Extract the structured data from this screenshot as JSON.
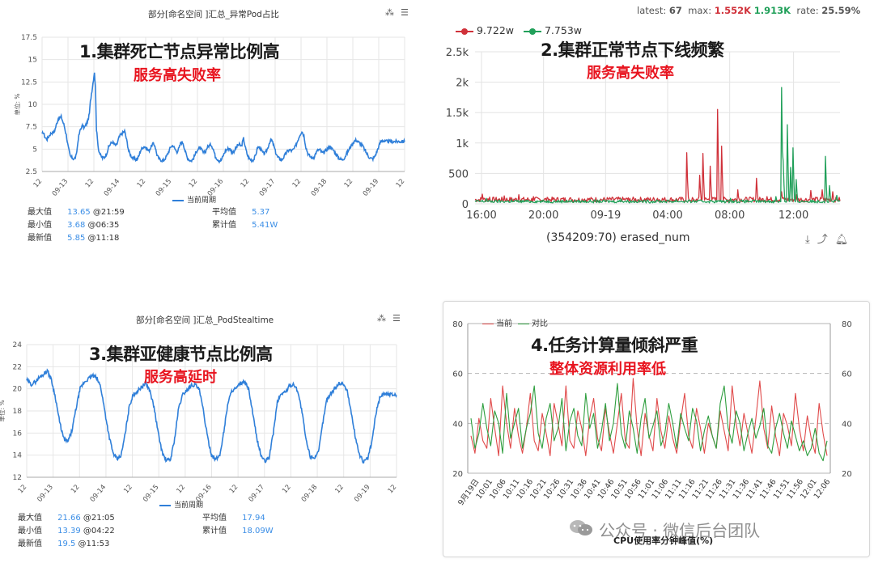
{
  "panel1": {
    "title": "部分[命名空间 ]汇总_异常Pod占比",
    "annotation_title": "1.集群死亡节点异常比例高",
    "annotation_sub": "服务高失败率",
    "legend": "当前周期",
    "stats": {
      "max_label": "最大值",
      "max_value": "13.65",
      "max_time": "@21:59",
      "min_label": "最小值",
      "min_value": "3.68",
      "min_time": "@06:35",
      "last_label": "最新值",
      "last_value": "5.85",
      "last_time": "@11:18",
      "avg_label": "平均值",
      "avg_value": "5.37",
      "sum_label": "累计值",
      "sum_value": "5.41W"
    }
  },
  "panel2": {
    "top_stats": {
      "latest_label": "latest:",
      "latest": "67",
      "max_label": "max:",
      "max_red": "1.552K",
      "max_green": "1.913K",
      "rate_label": "rate:",
      "rate": "25.59%"
    },
    "legend_red": "9.722w",
    "legend_green": "7.753w",
    "annotation_title": "2.集群正常节点下线频繁",
    "annotation_sub": "服务高失败率",
    "xlabel": "(354209:70) erased_num",
    "icons": [
      "download-icon",
      "share-icon",
      "bell-icon"
    ]
  },
  "panel3": {
    "title": "部分[命名空间 ]汇总_PodStealtime",
    "annotation_title": "3.集群亚健康节点比例高",
    "annotation_sub": "服务高延时",
    "legend": "当前周期",
    "stats": {
      "max_label": "最大值",
      "max_value": "21.66",
      "max_time": "@21:05",
      "min_label": "最小值",
      "min_value": "13.39",
      "min_time": "@04:22",
      "last_label": "最新值",
      "last_value": "19.5",
      "last_time": "@11:53",
      "avg_label": "平均值",
      "avg_value": "17.94",
      "sum_label": "累计值",
      "sum_value": "18.09W"
    }
  },
  "panel4": {
    "legend_red": "当前",
    "legend_green": "对比",
    "annotation_title": "4.任务计算量倾斜严重",
    "annotation_sub": "整体资源利用率低",
    "xlabel": "CPU使用率分钟峰值(%)"
  },
  "watermark": {
    "text": "公众号 · 微信后台团队"
  },
  "chart_data": [
    {
      "id": "panel1",
      "type": "line",
      "title": "部分[命名空间 ]汇总_异常Pod占比",
      "ylabel": "单位: %",
      "ylim": [
        2.5,
        17.5
      ],
      "yticks": [
        "2.5",
        "5",
        "7.5",
        "10",
        "12.5",
        "15",
        "17.5"
      ],
      "xticks": [
        "12",
        "09-13",
        "12",
        "09-14",
        "12",
        "09-15",
        "12",
        "09-16",
        "12",
        "09-17",
        "12",
        "09-18",
        "12",
        "09-19",
        "12"
      ],
      "series": [
        {
          "name": "当前周期",
          "color": "#2f7fd9",
          "t": [
            0,
            1,
            3,
            5,
            7,
            9,
            12,
            16,
            19,
            22,
            24,
            26,
            28,
            30,
            32,
            34,
            36,
            38,
            40,
            42,
            44,
            46,
            47,
            48,
            49,
            50,
            51,
            52,
            53,
            54,
            56,
            58,
            60,
            62,
            64,
            66,
            68,
            70,
            72,
            74,
            76,
            78,
            80,
            82,
            84,
            86,
            88,
            90,
            92,
            94,
            96,
            98,
            100,
            102,
            104,
            106,
            108,
            110,
            112,
            114,
            116,
            118,
            120,
            122,
            124,
            126,
            128,
            130,
            132,
            134,
            136,
            138,
            140,
            142,
            144,
            146,
            148,
            150,
            152,
            154,
            156,
            158,
            160,
            162,
            164,
            166,
            168,
            170,
            172,
            174,
            176,
            178,
            180,
            182,
            184,
            186,
            188,
            190,
            192,
            194,
            196,
            198,
            200,
            202,
            204,
            206,
            208,
            210,
            212,
            214,
            216,
            218,
            220,
            222,
            224,
            226,
            228,
            230,
            232,
            234,
            236,
            238,
            240,
            242,
            244,
            246,
            248,
            250,
            252,
            254,
            256,
            258,
            260,
            262,
            264,
            266,
            268,
            270,
            272,
            274,
            276,
            278,
            280,
            282,
            284,
            286,
            288,
            290,
            292,
            294,
            296,
            298,
            300,
            302,
            304,
            306,
            308,
            310,
            312,
            314,
            316,
            318,
            320,
            322,
            324,
            326,
            328,
            330,
            332,
            334,
            336,
            338,
            340,
            342,
            344,
            346,
            348,
            350,
            352,
            354,
            356,
            358,
            360
          ],
          "values": [
            6.6,
            6.9,
            6.3,
            6.1,
            6.5,
            6.8,
            6.9,
            8.4,
            8.6,
            7.6,
            6.6,
            5.2,
            4.2,
            4.0,
            3.9,
            4.3,
            6.2,
            7.2,
            7.6,
            7.4,
            7.8,
            8.4,
            9.0,
            10.3,
            11.2,
            11.9,
            12.8,
            13.65,
            11.8,
            7.2,
            5.0,
            4.3,
            4.0,
            4.1,
            4.5,
            5.2,
            5.6,
            5.8,
            5.5,
            5.4,
            6.2,
            6.6,
            6.8,
            7.0,
            6.0,
            4.8,
            4.3,
            4.0,
            3.9,
            3.8,
            4.2,
            4.9,
            5.2,
            5.3,
            5.0,
            4.8,
            5.2,
            5.6,
            5.4,
            4.4,
            3.9,
            3.8,
            3.7,
            3.9,
            4.3,
            4.8,
            5.3,
            5.4,
            5.0,
            4.7,
            5.1,
            5.8,
            5.7,
            4.8,
            4.1,
            3.8,
            3.7,
            3.9,
            4.4,
            4.9,
            5.1,
            5.0,
            4.6,
            4.7,
            5.2,
            5.4,
            5.5,
            5.0,
            4.2,
            3.9,
            3.7,
            3.8,
            4.3,
            4.8,
            5.0,
            5.1,
            4.7,
            4.7,
            5.0,
            5.4,
            5.5,
            5.3,
            6.2,
            5.1,
            4.3,
            3.9,
            3.8,
            3.8,
            4.3,
            5.2,
            5.2,
            4.8,
            4.5,
            4.6,
            5.1,
            5.8,
            6.0,
            5.4,
            4.6,
            4.1,
            3.9,
            3.8,
            4.1,
            4.5,
            4.8,
            4.9,
            4.8,
            5.0,
            5.4,
            6.0,
            6.6,
            7.0,
            6.5,
            5.2,
            4.5,
            4.2,
            4.0,
            4.1,
            4.6,
            4.9,
            4.9,
            4.6,
            4.6,
            4.9,
            5.1,
            5.3,
            5.0,
            4.8,
            4.4,
            4.1,
            3.9,
            3.8,
            4.0,
            4.4,
            4.8,
            5.2,
            5.6,
            5.9,
            6.0,
            5.8,
            5.6,
            5.4,
            5.0,
            4.6,
            4.2,
            4.0,
            3.9,
            4.1,
            4.6,
            5.2,
            5.8,
            6.0,
            5.85,
            5.85,
            5.85,
            5.85,
            5.85,
            5.85,
            5.85,
            5.85,
            5.85,
            5.85,
            5.85
          ]
        }
      ]
    },
    {
      "id": "panel2",
      "type": "line",
      "ylim": [
        0,
        2500
      ],
      "yticks": [
        "0",
        "500",
        "1k",
        "1.5k",
        "2k",
        "2.5k"
      ],
      "xticks": [
        "16:00",
        "20:00",
        "09-19",
        "04:00",
        "08:00",
        "12:00"
      ],
      "series": [
        {
          "name": "9.722w",
          "color": "#d0313a",
          "baseline": 70,
          "spikes": [
            [
              0.02,
              160
            ],
            [
              0.04,
              110
            ],
            [
              0.08,
              130
            ],
            [
              0.12,
              150
            ],
            [
              0.16,
              120
            ],
            [
              0.2,
              90
            ],
            [
              0.3,
              80
            ],
            [
              0.42,
              100
            ],
            [
              0.5,
              90
            ],
            [
              0.6,
              70
            ],
            [
              0.58,
              840
            ],
            [
              0.615,
              470
            ],
            [
              0.625,
              830
            ],
            [
              0.645,
              620
            ],
            [
              0.665,
              1552
            ],
            [
              0.675,
              950
            ],
            [
              0.72,
              230
            ],
            [
              0.77,
              420
            ],
            [
              0.8,
              120
            ],
            [
              0.84,
              200
            ],
            [
              0.88,
              150
            ],
            [
              0.92,
              220
            ],
            [
              0.95,
              230
            ],
            [
              0.98,
              200
            ]
          ]
        },
        {
          "name": "7.753w",
          "color": "#21a05a",
          "baseline": 40,
          "spikes": [
            [
              0.03,
              90
            ],
            [
              0.1,
              70
            ],
            [
              0.25,
              60
            ],
            [
              0.4,
              80
            ],
            [
              0.55,
              70
            ],
            [
              0.7,
              90
            ],
            [
              0.825,
              120
            ],
            [
              0.84,
              1913
            ],
            [
              0.845,
              700
            ],
            [
              0.855,
              1300
            ],
            [
              0.865,
              600
            ],
            [
              0.87,
              920
            ],
            [
              0.88,
              400
            ],
            [
              0.96,
              780
            ],
            [
              0.97,
              300
            ],
            [
              0.99,
              140
            ]
          ]
        }
      ]
    },
    {
      "id": "panel3",
      "type": "line",
      "title": "部分[命名空间 ]汇总_PodStealtime",
      "ylabel": "单位: %",
      "ylim": [
        12,
        24
      ],
      "yticks": [
        "12",
        "14",
        "16",
        "18",
        "20",
        "22",
        "24"
      ],
      "xticks": [
        "12",
        "09-13",
        "12",
        "09-14",
        "12",
        "09-15",
        "12",
        "09-16",
        "12",
        "09-17",
        "12",
        "09-18",
        "12",
        "09-19",
        "12"
      ],
      "series": [
        {
          "name": "当前周期",
          "color": "#2f7fd9",
          "t": [
            0,
            4,
            8,
            12,
            16,
            20,
            24,
            28,
            32,
            36,
            40,
            44,
            48,
            52,
            56,
            60,
            64,
            68,
            72,
            76,
            80,
            84,
            88,
            92,
            96,
            100,
            104,
            108,
            112,
            116,
            120,
            124,
            128,
            132,
            136,
            140,
            144,
            148,
            152,
            156,
            160,
            164,
            168,
            172,
            176,
            180,
            184,
            188,
            192,
            196,
            200,
            204,
            208,
            212,
            216,
            220,
            224,
            228,
            232,
            236,
            240,
            244,
            248,
            252,
            256,
            260,
            264,
            268,
            272,
            276,
            280,
            284,
            288,
            292,
            296,
            300,
            304,
            308,
            312,
            316,
            320,
            324,
            328,
            332,
            336,
            340,
            344,
            348,
            352,
            356,
            360
          ],
          "values": [
            20.8,
            20.4,
            20.6,
            21.0,
            21.3,
            21.66,
            20.8,
            19.2,
            17.0,
            15.5,
            15.2,
            16.2,
            18.2,
            20.0,
            20.6,
            20.9,
            21.2,
            21.0,
            20.2,
            18.0,
            15.8,
            14.2,
            13.6,
            14.0,
            16.0,
            18.5,
            19.5,
            19.8,
            20.2,
            20.5,
            19.8,
            18.3,
            16.0,
            14.2,
            13.5,
            13.6,
            15.5,
            18.3,
            19.5,
            19.9,
            20.3,
            20.4,
            19.9,
            18.0,
            15.6,
            14.0,
            13.6,
            14.0,
            16.2,
            18.8,
            19.9,
            20.0,
            20.5,
            20.6,
            20.0,
            17.8,
            15.5,
            14.0,
            13.4,
            13.8,
            16.0,
            18.8,
            19.6,
            19.7,
            20.3,
            20.4,
            19.8,
            17.9,
            15.3,
            13.9,
            13.8,
            14.2,
            16.8,
            19.0,
            19.6,
            20.0,
            20.5,
            20.5,
            19.8,
            17.8,
            15.6,
            14.0,
            13.39,
            13.7,
            15.2,
            17.8,
            19.3,
            19.6,
            19.5,
            19.5,
            19.5
          ]
        }
      ]
    },
    {
      "id": "panel4",
      "type": "line",
      "xlabel": "CPU使用率分钟峰值(%)",
      "ylim": [
        20,
        80
      ],
      "yticks": [
        "20",
        "40",
        "60",
        "80"
      ],
      "xticks": [
        "9月19日",
        "10:01",
        "10:06",
        "10:11",
        "10:16",
        "10:21",
        "10:26",
        "10:31",
        "10:36",
        "10:41",
        "10:46",
        "10:51",
        "10:56",
        "11:01",
        "11:06",
        "11:11",
        "11:16",
        "11:21",
        "11:26",
        "11:31",
        "11:36",
        "11:41",
        "11:46",
        "11:51",
        "11:56",
        "12:01",
        "12:06"
      ],
      "series": [
        {
          "name": "当前",
          "color": "#e04a4a",
          "values": [
            35,
            28,
            42,
            33,
            30,
            50,
            38,
            27,
            55,
            40,
            30,
            46,
            35,
            28,
            38,
            52,
            33,
            29,
            44,
            36,
            27,
            48,
            40,
            31,
            55,
            33,
            30,
            45,
            38,
            27,
            42,
            50,
            34,
            29,
            46,
            36,
            28,
            40,
            52,
            33,
            30,
            58,
            38,
            27,
            44,
            35,
            29,
            50,
            37,
            30,
            43,
            34,
            28,
            41,
            52,
            35,
            30,
            46,
            38,
            28,
            40,
            35,
            30,
            45,
            37,
            29,
            55,
            40,
            31,
            44,
            36,
            28,
            42,
            57,
            38,
            30,
            47,
            35,
            27,
            44,
            39,
            31,
            52,
            38,
            29,
            43,
            34,
            28,
            48,
            36,
            27
          ]
        },
        {
          "name": "对比",
          "color": "#2e9e3e",
          "values": [
            42,
            30,
            36,
            48,
            38,
            31,
            45,
            40,
            28,
            52,
            34,
            40,
            46,
            30,
            38,
            44,
            55,
            36,
            30,
            42,
            48,
            33,
            38,
            50,
            29,
            41,
            46,
            35,
            31,
            52,
            38,
            44,
            30,
            37,
            48,
            33,
            40,
            56,
            36,
            30,
            45,
            38,
            28,
            42,
            50,
            34,
            39,
            45,
            31,
            36,
            48,
            40,
            30,
            44,
            38,
            33,
            46,
            41,
            29,
            37,
            43,
            35,
            30,
            48,
            55,
            38,
            32,
            45,
            40,
            29,
            36,
            42,
            34,
            39,
            46,
            31,
            28,
            38,
            44,
            36,
            30,
            41,
            35,
            29,
            33,
            27,
            30,
            38,
            28,
            25,
            33
          ]
        }
      ]
    }
  ]
}
